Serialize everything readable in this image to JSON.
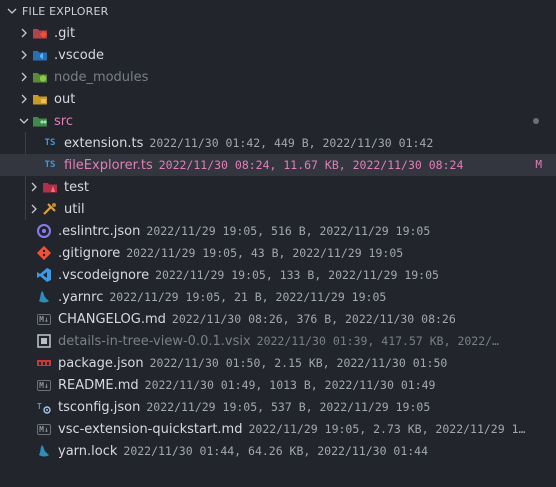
{
  "header": {
    "title": "FILE EXPLORER"
  },
  "colors": {
    "background": "#22252c",
    "selected": "#33363f",
    "accent": "#e07fb8"
  },
  "tree": [
    {
      "name": ".git",
      "icon": "git-folder-icon",
      "meta": ""
    },
    {
      "name": ".vscode",
      "icon": "vscode-folder-icon",
      "meta": ""
    },
    {
      "name": "node_modules",
      "icon": "node-folder-icon",
      "meta": ""
    },
    {
      "name": "out",
      "icon": "out-folder-icon",
      "meta": ""
    },
    {
      "name": "src",
      "icon": "src-folder-icon",
      "meta": ""
    },
    {
      "name": "extension.ts",
      "icon": "typescript-icon",
      "meta": "2022/11/30 01:42, 449 B, 2022/11/30 01:42"
    },
    {
      "name": "fileExplorer.ts",
      "icon": "typescript-icon",
      "meta": "2022/11/30 08:24, 11.67 KB, 2022/11/30 08:24",
      "badge": "M"
    },
    {
      "name": "test",
      "icon": "test-folder-icon",
      "meta": ""
    },
    {
      "name": "util",
      "icon": "util-folder-icon",
      "meta": ""
    },
    {
      "name": ".eslintrc.json",
      "icon": "eslint-icon",
      "meta": "2022/11/29 19:05, 516 B, 2022/11/29 19:05"
    },
    {
      "name": ".gitignore",
      "icon": "git-icon",
      "meta": "2022/11/29 19:05, 43 B, 2022/11/29 19:05"
    },
    {
      "name": ".vscodeignore",
      "icon": "vscode-icon",
      "meta": "2022/11/29 19:05, 133 B, 2022/11/29 19:05"
    },
    {
      "name": ".yarnrc",
      "icon": "yarn-icon",
      "meta": "2022/11/29 19:05, 21 B, 2022/11/29 19:05"
    },
    {
      "name": "CHANGELOG.md",
      "icon": "markdown-icon",
      "meta": "2022/11/30 08:26, 376 B, 2022/11/30 08:26"
    },
    {
      "name": "details-in-tree-view-0.0.1.vsix",
      "icon": "package-icon",
      "meta": "2022/11/30 01:39, 417.57 KB, 2022/…"
    },
    {
      "name": "package.json",
      "icon": "npm-icon",
      "meta": "2022/11/30 01:50, 2.15 KB, 2022/11/30 01:50"
    },
    {
      "name": "README.md",
      "icon": "markdown-icon",
      "meta": "2022/11/30 01:49, 1013 B, 2022/11/30 01:49"
    },
    {
      "name": "tsconfig.json",
      "icon": "tsconfig-icon",
      "meta": "2022/11/29 19:05, 537 B, 2022/11/29 19:05"
    },
    {
      "name": "vsc-extension-quickstart.md",
      "icon": "markdown-icon",
      "meta": "2022/11/29 19:05, 2.73 KB, 2022/11/29 1…"
    },
    {
      "name": "yarn.lock",
      "icon": "yarn-icon",
      "meta": "2022/11/30 01:44, 64.26 KB, 2022/11/30 01:44"
    }
  ]
}
